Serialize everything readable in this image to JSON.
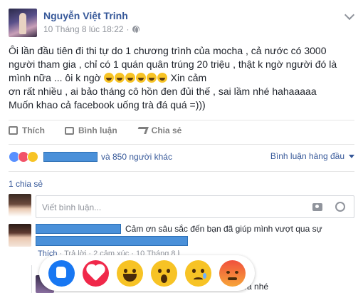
{
  "post": {
    "author": "Nguyễn Việt Trinh",
    "timestamp": "10 Tháng 8 lúc 18:22",
    "text_lines": [
      "Ôi lần đầu tiên đi thi tự do 1 chương trình của mocha , cả nước có 3000",
      "người tham gia , chỉ có 1 quán quân trúng 20 triệu , thật k ngờ người đó là",
      "mình nữa ... ôi k ngờ",
      "Xin cảm",
      "ơn rất nhiều , ai bảo tháng cô hồn đen đủi thế , sai lầm nhé hahaaaaa",
      "Muốn khao cả facebook uống trà đá quá =)))"
    ],
    "emoji_count": 6
  },
  "actions": {
    "like": "Thích",
    "comment": "Bình luận",
    "share": "Chia sẻ"
  },
  "reactions": {
    "others_text": "và 850 người khác",
    "sort_label": "Bình luận hàng đầu"
  },
  "shares_text": "1 chia sẻ",
  "composer": {
    "placeholder": "Viết bình luận..."
  },
  "comment": {
    "text": "Cảm ơn sâu sắc đến bạn đã giúp mình vượt qua sự",
    "like_label": "Thích",
    "meta_text": "· Trả lời · 2 cảm xúc · 10 Tháng 8 lúc 18:25"
  },
  "reply_tail_text": "ưa nhé",
  "reaction_picker": [
    "like",
    "love",
    "haha",
    "wow",
    "sad",
    "angry"
  ],
  "colors": {
    "link": "#365899",
    "muted": "#90949c",
    "like_blue": "#1877f2",
    "love_red": "#f0284a",
    "emoji_yellow": "#f7c325",
    "mask_blue": "#4a90d9"
  }
}
